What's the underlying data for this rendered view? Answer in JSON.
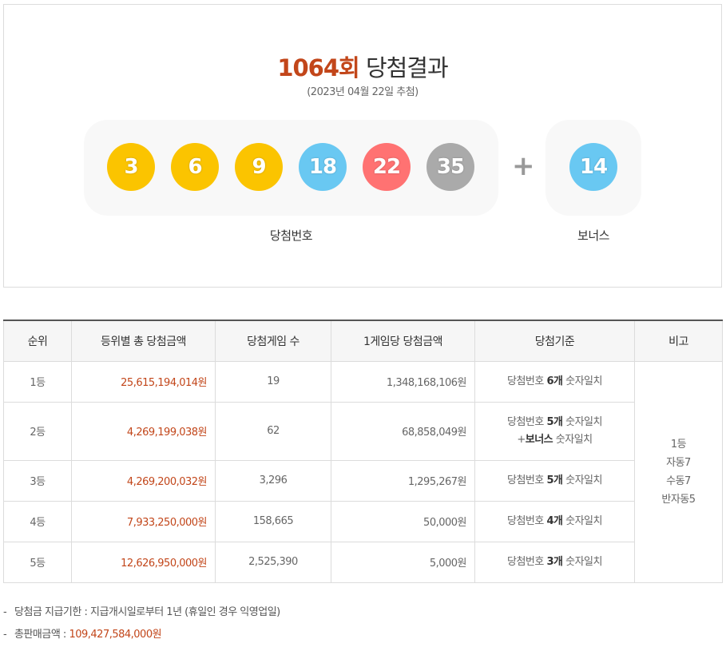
{
  "header": {
    "round": "1064회",
    "title_suffix": "당첨결과",
    "draw_date": "(2023년 04월 22일 추첨)"
  },
  "winning_numbers": [
    {
      "number": "3",
      "color": "#fbc400"
    },
    {
      "number": "6",
      "color": "#fbc400"
    },
    {
      "number": "9",
      "color": "#fbc400"
    },
    {
      "number": "18",
      "color": "#69c8f2"
    },
    {
      "number": "22",
      "color": "#ff7272"
    },
    {
      "number": "35",
      "color": "#aaaaaa"
    }
  ],
  "plus_sign": "+",
  "bonus": {
    "number": "14",
    "color": "#69c8f2"
  },
  "labels": {
    "main": "당첨번호",
    "bonus": "보너스"
  },
  "table": {
    "headers": [
      "순위",
      "등위별 총 당첨금액",
      "당첨게임 수",
      "1게임당 당첨금액",
      "당첨기준",
      "비고"
    ],
    "rows": [
      {
        "rank": "1등",
        "total": "25,615,194,014원",
        "count": "19",
        "per_game": "1,348,168,106원",
        "criteria": {
          "prefix": "당첨번호 ",
          "bold": "6개",
          "suffix": " 숫자일치"
        }
      },
      {
        "rank": "2등",
        "total": "4,269,199,038원",
        "count": "62",
        "per_game": "68,858,049원",
        "criteria": {
          "prefix": "당첨번호 ",
          "bold": "5개",
          "suffix": " 숫자일치",
          "line2_prefix": "+",
          "line2_bold": "보너스",
          "line2_suffix": " 숫자일치"
        }
      },
      {
        "rank": "3등",
        "total": "4,269,200,032원",
        "count": "3,296",
        "per_game": "1,295,267원",
        "criteria": {
          "prefix": "당첨번호 ",
          "bold": "5개",
          "suffix": " 숫자일치"
        }
      },
      {
        "rank": "4등",
        "total": "7,933,250,000원",
        "count": "158,665",
        "per_game": "50,000원",
        "criteria": {
          "prefix": "당첨번호 ",
          "bold": "4개",
          "suffix": " 숫자일치"
        }
      },
      {
        "rank": "5등",
        "total": "12,626,950,000원",
        "count": "2,525,390",
        "per_game": "5,000원",
        "criteria": {
          "prefix": "당첨번호 ",
          "bold": "3개",
          "suffix": " 숫자일치"
        }
      }
    ],
    "note": [
      "1등",
      "자동7",
      "수동7",
      "반자동5"
    ]
  },
  "footer": {
    "dash": "-",
    "deadline_text": "당첨금 지급기한 : 지급개시일로부터 1년 (휴일인 경우 익영업일)",
    "sales_label": "총판매금액 : ",
    "sales_amount": "109,427,584,000원"
  }
}
